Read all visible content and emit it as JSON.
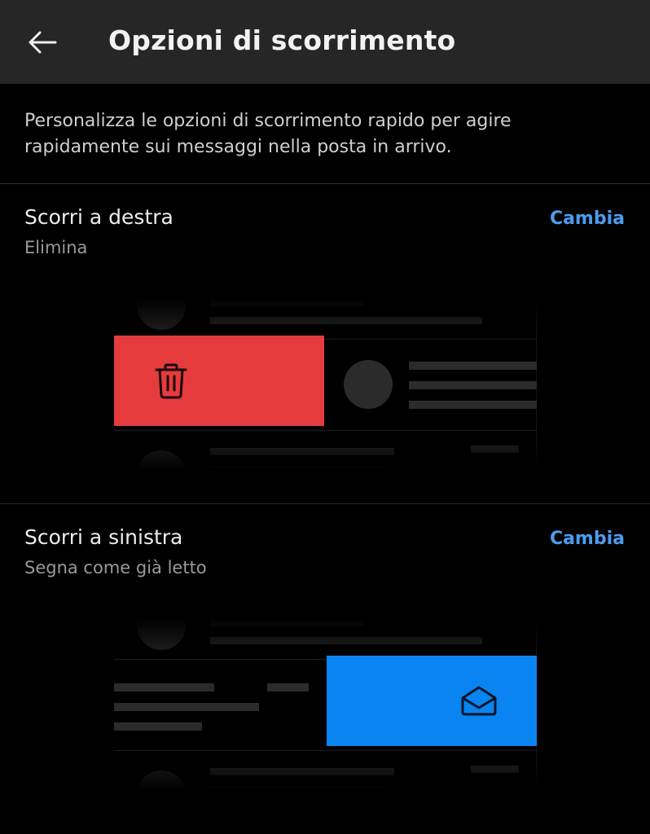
{
  "header": {
    "title": "Opzioni di scorrimento",
    "back_icon": "arrow-left-icon"
  },
  "intro": "Personalizza le opzioni di scorrimento rapido per agire rapidamente sui messaggi nella posta in arrivo.",
  "swipe_right": {
    "title": "Scorri a destra",
    "value": "Elimina",
    "change_label": "Cambia",
    "action_color": "#e53b3d",
    "action_icon": "trash-icon"
  },
  "swipe_left": {
    "title": "Scorri a sinistra",
    "value": "Segna come già letto",
    "change_label": "Cambia",
    "action_color": "#0a84f0",
    "action_icon": "envelope-open-icon"
  },
  "colors": {
    "header_bg": "#262626",
    "link": "#4d9cf0"
  }
}
